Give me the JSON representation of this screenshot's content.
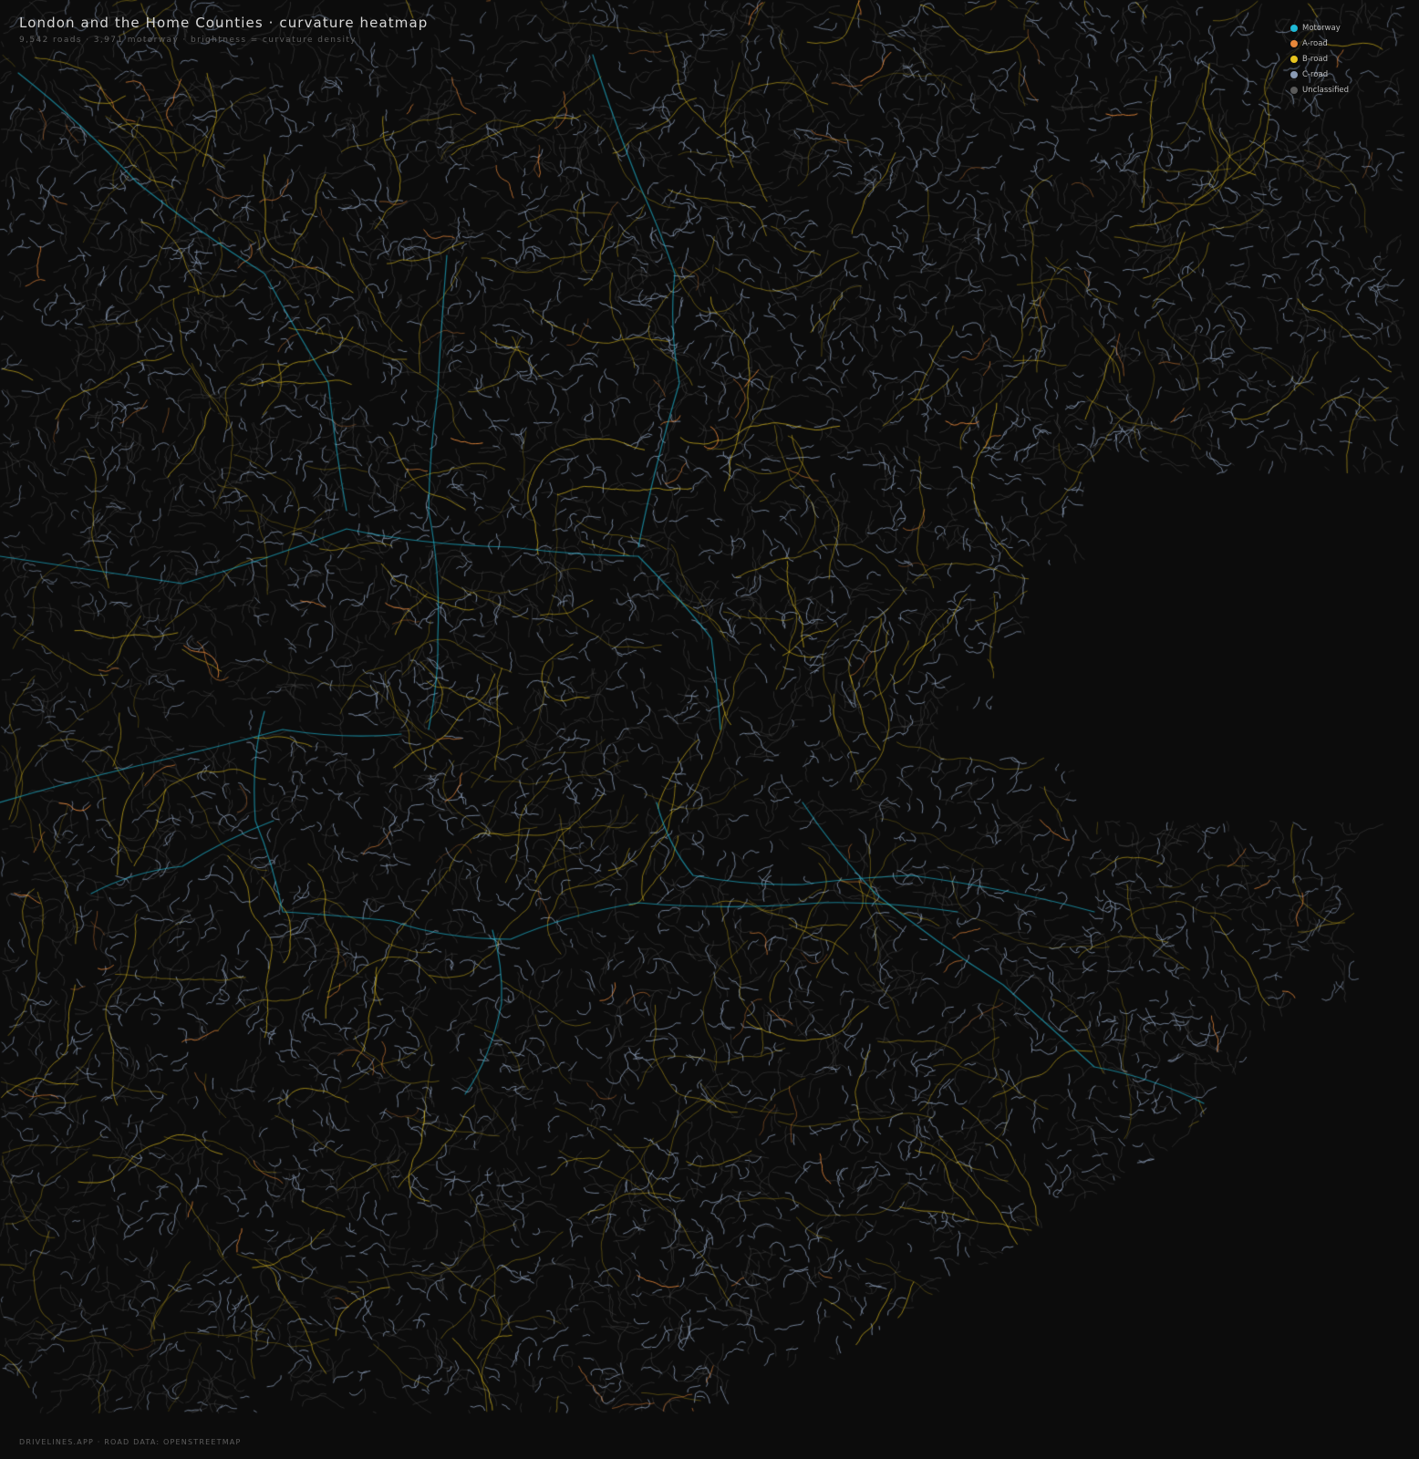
{
  "header": {
    "title": "London and the Home Counties · curvature heatmap",
    "subtitle": "9,542 roads · 3,971 motorway · brightness = curvature density"
  },
  "legend": {
    "items": [
      {
        "label": "Motorway",
        "color": "#1fb9d6"
      },
      {
        "label": "A-road",
        "color": "#e8883a"
      },
      {
        "label": "B-road",
        "color": "#e8c51e"
      },
      {
        "label": "C-road",
        "color": "#8a9bb5"
      },
      {
        "label": "Unclassified",
        "color": "#5a5a5a"
      }
    ]
  },
  "footer": {
    "credit": "DRIVELINES.APP · ROAD DATA: OPENSTREETMAP"
  }
}
